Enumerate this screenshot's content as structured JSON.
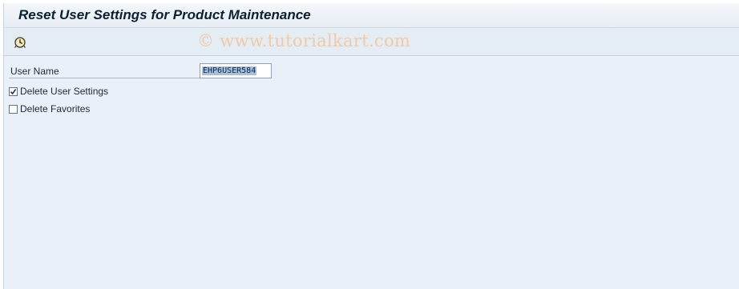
{
  "window": {
    "title": "Reset User Settings for Product Maintenance"
  },
  "toolbar": {
    "execute_icon": "execute-clock-icon",
    "watermark": "© www.tutorialkart.com"
  },
  "form": {
    "user_name_label": "User Name",
    "user_name_value": "EHP6USER584",
    "delete_user_settings": {
      "label": "Delete User Settings",
      "checked": true
    },
    "delete_favorites": {
      "label": "Delete Favorites",
      "checked": false
    }
  }
}
